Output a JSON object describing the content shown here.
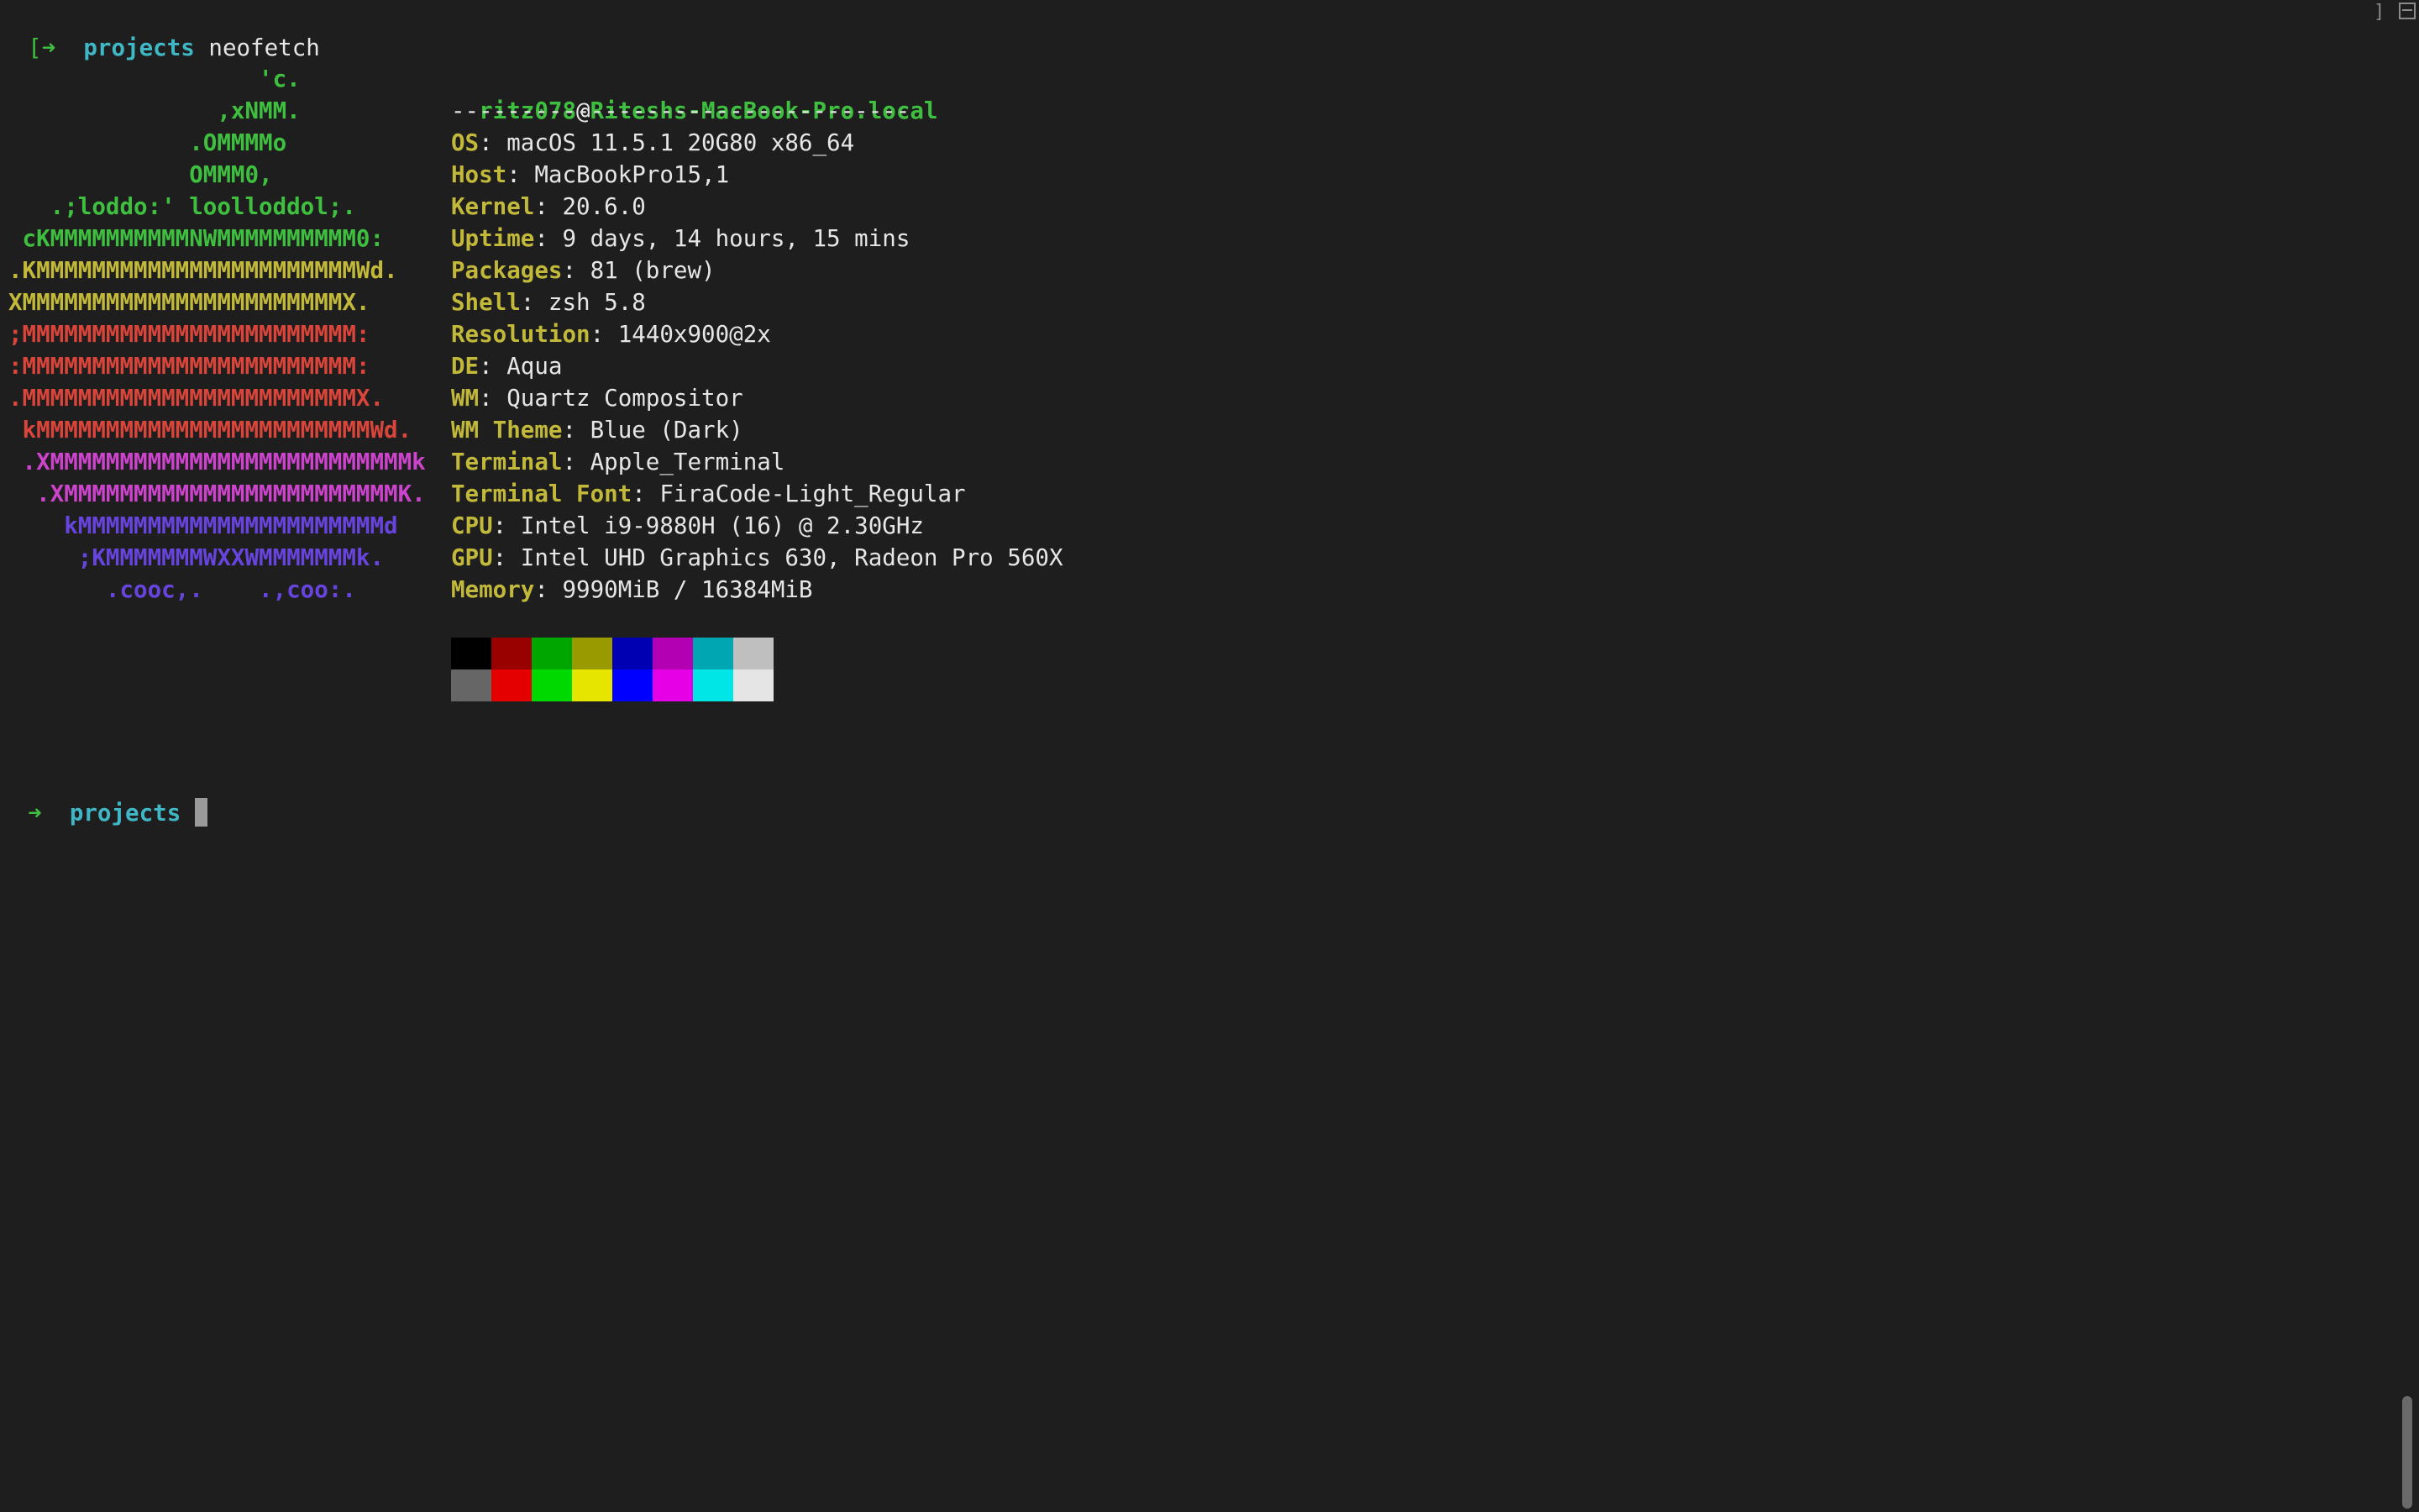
{
  "terminal": {
    "first_prompt": {
      "bracket": "[",
      "arrow": "➜",
      "dir": "projects",
      "command": "neofetch"
    },
    "last_prompt": {
      "arrow": "➜",
      "dir": "projects"
    },
    "top_right_mark": "]"
  },
  "logo_lines": [
    {
      "text": "                  'c.",
      "color": "#3fbf3f"
    },
    {
      "text": "               ,xNMM.",
      "color": "#3fbf3f"
    },
    {
      "text": "             .OMMMMo",
      "color": "#3fbf3f"
    },
    {
      "text": "             OMMM0,",
      "color": "#3fbf3f"
    },
    {
      "text": "   .;loddo:' loolloddol;.",
      "color": "#3fbf3f"
    },
    {
      "text": " cKMMMMMMMMMMNWMMMMMMMMMM0:",
      "color": "#3fbf3f"
    },
    {
      "text": ".KMMMMMMMMMMMMMMMMMMMMMMMWd.",
      "color": "#c2b93a"
    },
    {
      "text": "XMMMMMMMMMMMMMMMMMMMMMMMX.",
      "color": "#c2b93a"
    },
    {
      "text": ";MMMMMMMMMMMMMMMMMMMMMMMM:",
      "color": "#d9453a"
    },
    {
      "text": ":MMMMMMMMMMMMMMMMMMMMMMMM:",
      "color": "#d9453a"
    },
    {
      "text": ".MMMMMMMMMMMMMMMMMMMMMMMMX.",
      "color": "#d9453a"
    },
    {
      "text": " kMMMMMMMMMMMMMMMMMMMMMMMMWd.",
      "color": "#d9453a"
    },
    {
      "text": " .XMMMMMMMMMMMMMMMMMMMMMMMMMMk",
      "color": "#cc44cc"
    },
    {
      "text": "  .XMMMMMMMMMMMMMMMMMMMMMMMMK.",
      "color": "#cc44cc"
    },
    {
      "text": "    kMMMMMMMMMMMMMMMMMMMMMMd",
      "color": "#6644dd"
    },
    {
      "text": "     ;KMMMMMMMWXXWMMMMMMMk.",
      "color": "#6644dd"
    },
    {
      "text": "       .cooc,.    .,coo:.",
      "color": "#6644dd"
    }
  ],
  "header": {
    "user": "ritz078",
    "at": "@",
    "host": "Riteshs-MacBook-Pro.local",
    "dashes": "---------------------------------"
  },
  "info": [
    {
      "key": "OS",
      "value": "macOS 11.5.1 20G80 x86_64"
    },
    {
      "key": "Host",
      "value": "MacBookPro15,1"
    },
    {
      "key": "Kernel",
      "value": "20.6.0"
    },
    {
      "key": "Uptime",
      "value": "9 days, 14 hours, 15 mins"
    },
    {
      "key": "Packages",
      "value": "81 (brew)"
    },
    {
      "key": "Shell",
      "value": "zsh 5.8"
    },
    {
      "key": "Resolution",
      "value": "1440x900@2x"
    },
    {
      "key": "DE",
      "value": "Aqua"
    },
    {
      "key": "WM",
      "value": "Quartz Compositor"
    },
    {
      "key": "WM Theme",
      "value": "Blue (Dark)"
    },
    {
      "key": "Terminal",
      "value": "Apple_Terminal"
    },
    {
      "key": "Terminal Font",
      "value": "FiraCode-Light_Regular"
    },
    {
      "key": "CPU",
      "value": "Intel i9-9880H (16) @ 2.30GHz"
    },
    {
      "key": "GPU",
      "value": "Intel UHD Graphics 630, Radeon Pro 560X"
    },
    {
      "key": "Memory",
      "value": "9990MiB / 16384MiB"
    }
  ],
  "key_separator": ": ",
  "palette": [
    "#000000",
    "#990000",
    "#00a600",
    "#999900",
    "#0000b2",
    "#b200b2",
    "#00a6b2",
    "#bfbfbf",
    "#666666",
    "#e50000",
    "#00d900",
    "#e5e500",
    "#0000ff",
    "#e500e5",
    "#00e5e5",
    "#e5e5e5"
  ]
}
